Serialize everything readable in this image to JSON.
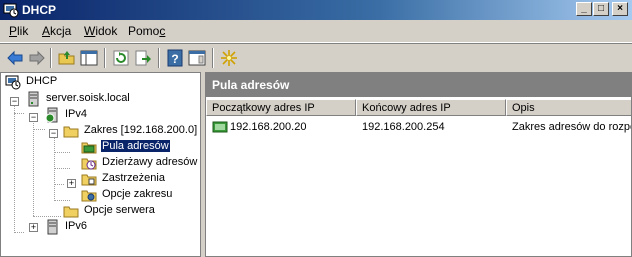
{
  "window": {
    "title": "DHCP"
  },
  "menu": {
    "items": [
      {
        "label": "Plik",
        "u": "P",
        "rest": "lik"
      },
      {
        "label": "Akcja",
        "u": "A",
        "rest": "kcja"
      },
      {
        "label": "Widok",
        "u": "W",
        "rest": "idok"
      },
      {
        "label": "Pomoc",
        "pre": "Pomo",
        "u": "c"
      }
    ]
  },
  "toolbar": {
    "icons": [
      "back-arrow-icon",
      "forward-arrow-icon",
      "up-folder-icon",
      "show-hide-tree-icon",
      "refresh-icon",
      "export-list-icon",
      "help-icon",
      "properties-icon",
      "new-scope-icon"
    ]
  },
  "tree": {
    "root": "DHCP",
    "server": "server.soisk.local",
    "ipv4": "IPv4",
    "scope": "Zakres [192.168.200.0]",
    "pool": "Pula adresów",
    "leases": "Dzierżawy adresów",
    "reservations": "Zastrzeżenia",
    "scope_options": "Opcje zakresu",
    "server_options": "Opcje serwera",
    "ipv6": "IPv6"
  },
  "details": {
    "header": "Pula adresów",
    "columns": [
      "Początkowy adres IP",
      "Końcowy adres IP",
      "Opis"
    ],
    "rows": [
      {
        "start": "192.168.200.20",
        "end": "192.168.200.254",
        "description": "Zakres adresów do rozpe"
      }
    ]
  },
  "colors": {
    "selection": "#0a246a",
    "pane_header": "#808080",
    "titlebar": "#0a246a"
  }
}
